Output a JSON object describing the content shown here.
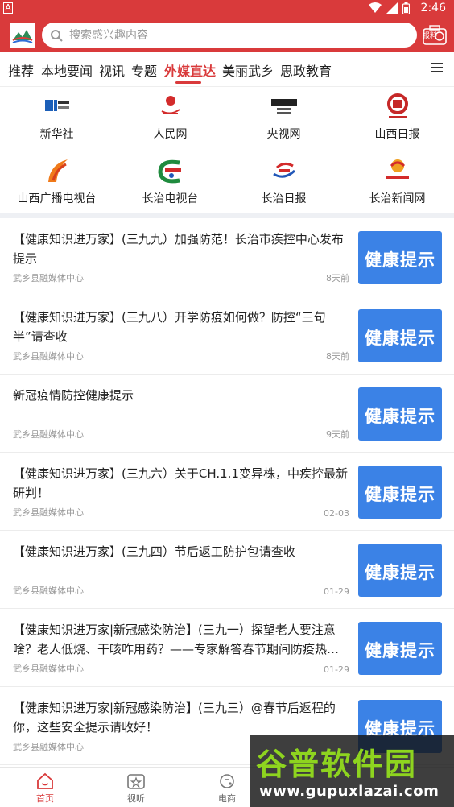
{
  "status_bar": {
    "indicator": "A",
    "time": "2:46"
  },
  "header": {
    "search_placeholder": "搜索感兴趣内容",
    "report_label": "报料"
  },
  "tabs": [
    {
      "label": "推荐"
    },
    {
      "label": "本地要闻"
    },
    {
      "label": "视讯"
    },
    {
      "label": "专题"
    },
    {
      "label": "外媒直达",
      "active": true
    },
    {
      "label": "美丽武乡"
    },
    {
      "label": "思政教育"
    }
  ],
  "media": [
    {
      "label": "新华社",
      "icon": "xinhua-logo-icon"
    },
    {
      "label": "人民网",
      "icon": "people-logo-icon"
    },
    {
      "label": "央视网",
      "icon": "cctv-logo-icon"
    },
    {
      "label": "山西日报",
      "icon": "shanxi-daily-logo-icon"
    },
    {
      "label": "山西广播电视台",
      "icon": "shanxi-tv-logo-icon"
    },
    {
      "label": "长治电视台",
      "icon": "changzhi-tv-logo-icon"
    },
    {
      "label": "长治日报",
      "icon": "changzhi-daily-logo-icon"
    },
    {
      "label": "长治新闻网",
      "icon": "changzhi-news-logo-icon"
    }
  ],
  "news": [
    {
      "title": "【健康知识进万家】(三九九）加强防范！长治市疾控中心发布提示",
      "source": "武乡县融媒体中心",
      "time": "8天前",
      "thumb": "健康提示"
    },
    {
      "title": "【健康知识进万家】(三九八）开学防疫如何做？防控“三句半”请查收",
      "source": "武乡县融媒体中心",
      "time": "8天前",
      "thumb": "健康提示"
    },
    {
      "title": "新冠疫情防控健康提示",
      "source": "武乡县融媒体中心",
      "time": "9天前",
      "thumb": "健康提示"
    },
    {
      "title": "【健康知识进万家】(三九六）关于CH.1.1变异株，中疾控最新研判！",
      "source": "武乡县融媒体中心",
      "time": "02-03",
      "thumb": "健康提示"
    },
    {
      "title": "【健康知识进万家】(三九四）节后返工防护包请查收",
      "source": "武乡县融媒体中心",
      "time": "01-29",
      "thumb": "健康提示"
    },
    {
      "title": "【健康知识进万家|新冠感染防治】(三九一）探望老人要注意啥？老人低烧、干咳咋用药？——专家解答春节期间防疫热…",
      "source": "武乡县融媒体中心",
      "time": "01-29",
      "thumb": "健康提示"
    },
    {
      "title": "【健康知识进万家|新冠感染防治】(三九三）@春节后返程的你，这些安全提示请收好！",
      "source": "武乡县融媒体中心",
      "time": "",
      "thumb": "健康提示"
    }
  ],
  "bottom_nav": [
    {
      "label": "首页",
      "icon": "home-icon",
      "active": true
    },
    {
      "label": "视听",
      "icon": "video-star-icon"
    },
    {
      "label": "电商",
      "icon": "shop-icon"
    }
  ],
  "watermark": {
    "text": "谷普软件园",
    "url": "www.gupuxlazai.com"
  },
  "colors": {
    "brand_red": "#d93a3b",
    "thumb_blue": "#3b82e6"
  }
}
